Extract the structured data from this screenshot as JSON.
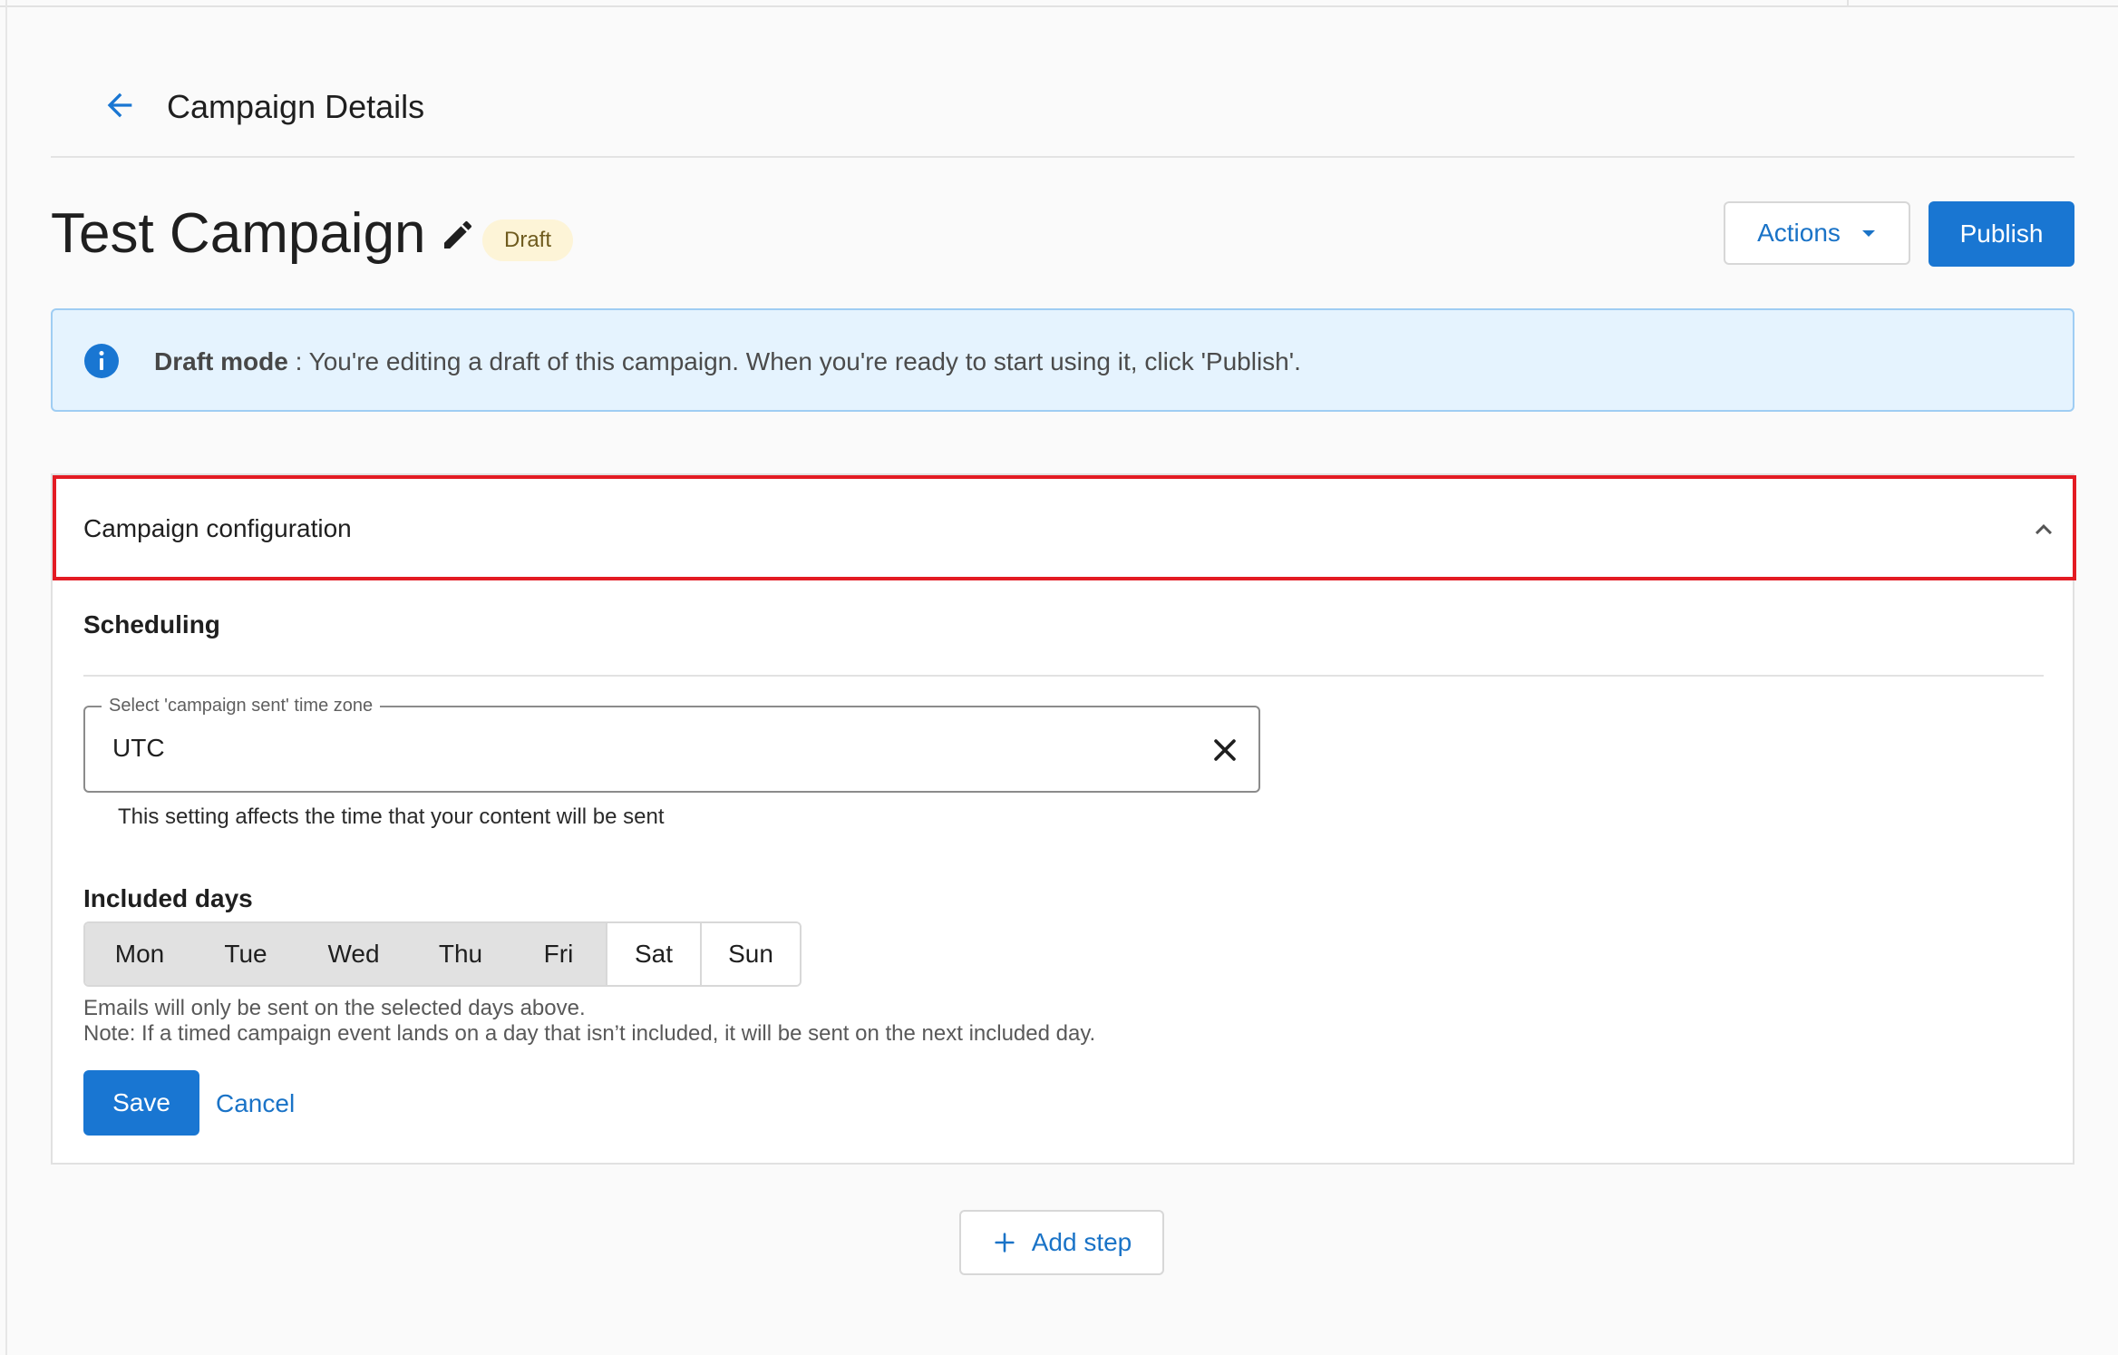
{
  "header": {
    "back_icon": "arrow-left-icon",
    "title": "Campaign Details"
  },
  "campaign": {
    "name": "Test Campaign",
    "edit_icon": "pencil-icon",
    "status": "Draft"
  },
  "toolbar": {
    "actions_label": "Actions",
    "actions_icon": "caret-down-icon",
    "publish_label": "Publish"
  },
  "banner": {
    "icon": "info-icon",
    "strong": "Draft mode",
    "message": " : You're editing a draft of this campaign. When you're ready to start using it, click 'Publish'."
  },
  "config": {
    "title": "Campaign configuration",
    "collapse_icon": "chevron-up-icon",
    "scheduling_title": "Scheduling",
    "timezone": {
      "label": "Select 'campaign sent' time zone",
      "value": "UTC",
      "clear_icon": "close-icon",
      "help": "This setting affects the time that your content will be sent"
    },
    "included_days": {
      "title": "Included days",
      "days": [
        {
          "label": "Mon",
          "selected": true
        },
        {
          "label": "Tue",
          "selected": true
        },
        {
          "label": "Wed",
          "selected": true
        },
        {
          "label": "Thu",
          "selected": true
        },
        {
          "label": "Fri",
          "selected": true
        },
        {
          "label": "Sat",
          "selected": false
        },
        {
          "label": "Sun",
          "selected": false
        }
      ],
      "help_line1": "Emails will only be sent on the selected days above.",
      "help_line2": "Note: If a timed campaign event lands on a day that isn’t included, it will be sent on the next included day."
    },
    "save_label": "Save",
    "cancel_label": "Cancel"
  },
  "add_step": {
    "icon": "plus-icon",
    "label": "Add step"
  },
  "colors": {
    "primary": "#1976d2",
    "link": "#1a73c7",
    "banner_bg": "#e5f3fe",
    "banner_border": "#9fcdf3",
    "badge_bg": "#fdf4d7",
    "highlight_border": "#e31b23"
  }
}
